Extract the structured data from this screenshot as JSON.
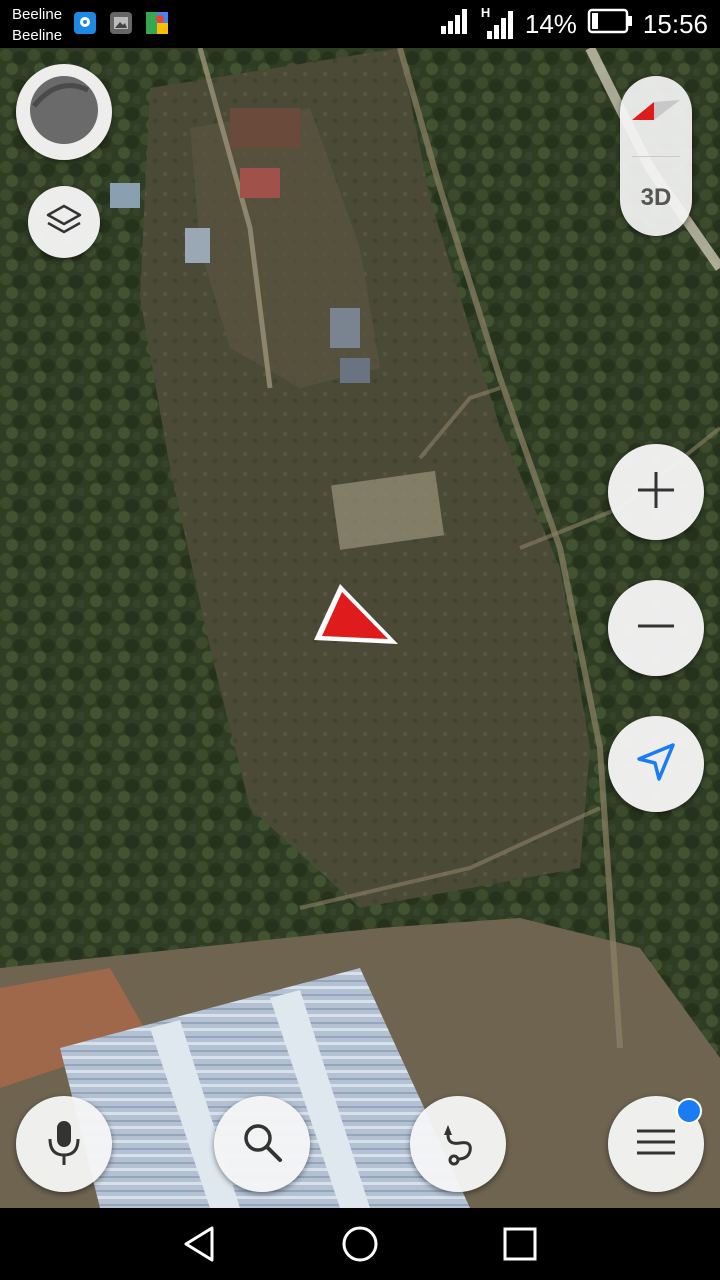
{
  "status_bar": {
    "carrier_line1": "Beeline",
    "carrier_line2": "Beeline",
    "battery_percent": "14%",
    "time": "15:56",
    "network_label": "H",
    "icons": [
      "location-app-icon",
      "gallery-icon",
      "maps-icon",
      "signal-icon",
      "signal-h-icon",
      "battery-icon"
    ]
  },
  "map": {
    "mode": "satellite",
    "compass_label": "3D",
    "colors": {
      "forest": "#2c3a22",
      "field": "#4a4a36",
      "greenhouse": "#b9c7d6",
      "location_arrow": "#e01b1b",
      "accent_blue": "#1a7cf4"
    }
  },
  "controls": {
    "left": [
      "profile-avatar",
      "layers-button"
    ],
    "right": [
      "compass-3d-toggle",
      "zoom-in-button",
      "zoom-out-button",
      "my-location-button"
    ],
    "bottom": [
      "voice-search-button",
      "search-button",
      "route-button",
      "menu-button"
    ],
    "menu_has_notification": true
  },
  "nav_bar": {
    "buttons": [
      "back-icon",
      "home-icon",
      "recents-icon"
    ]
  }
}
